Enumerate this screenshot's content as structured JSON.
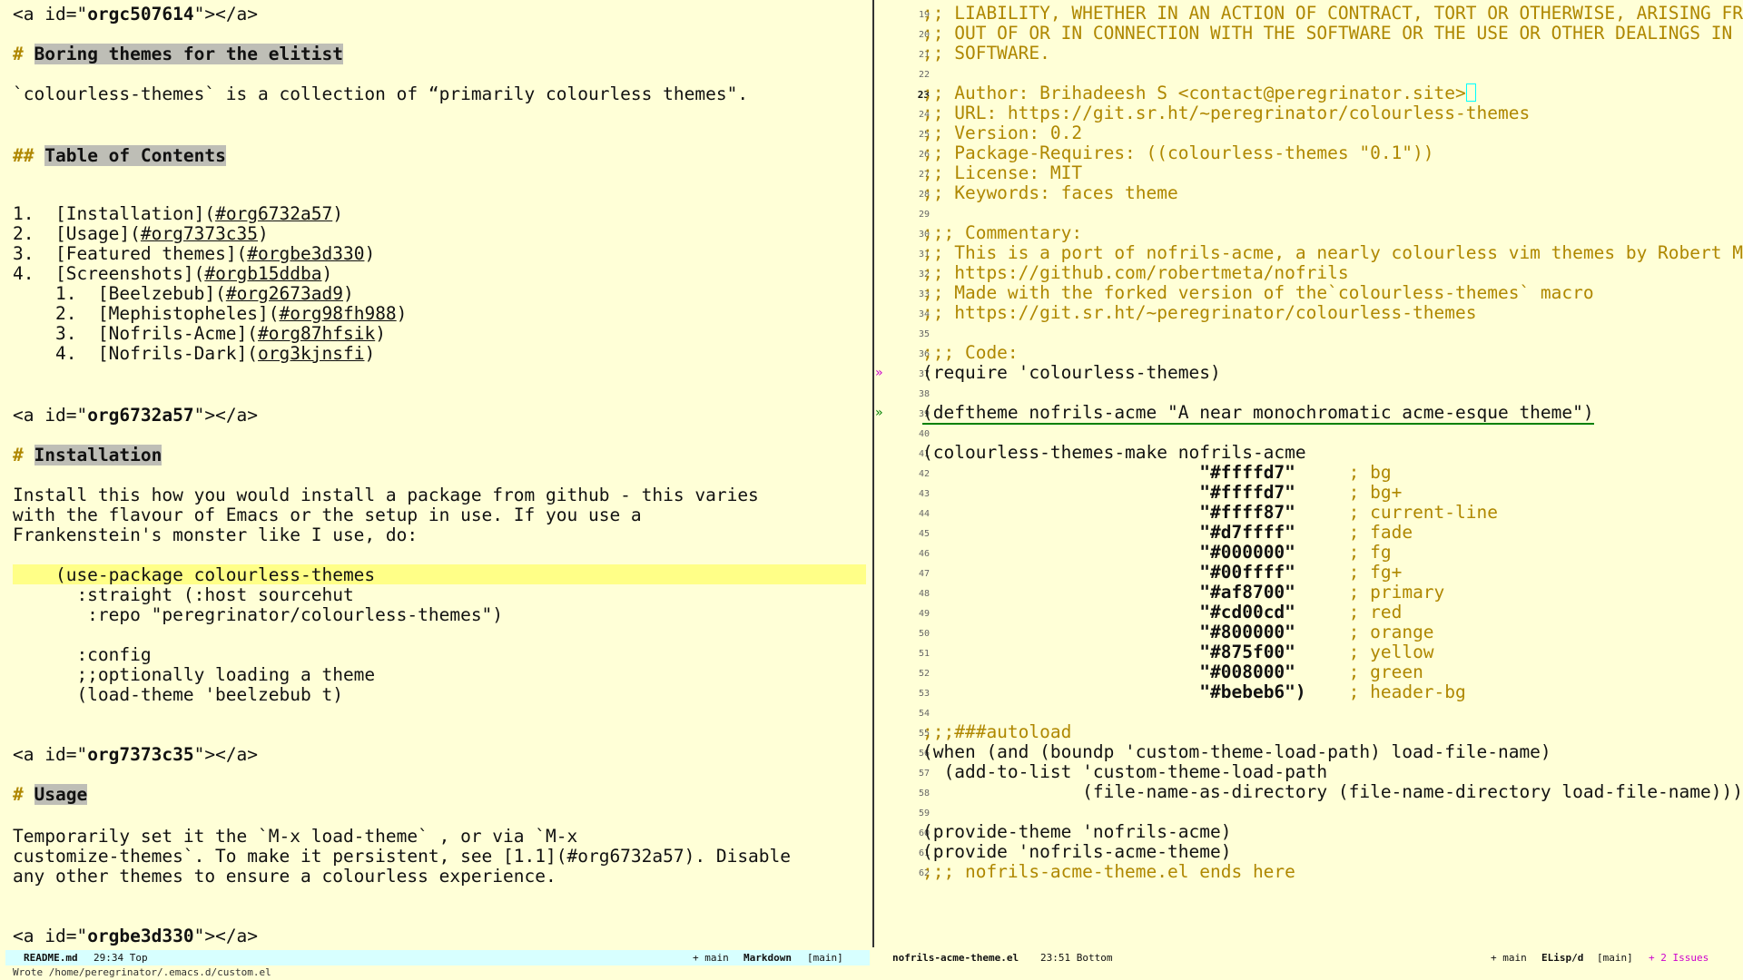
{
  "left_buffer": {
    "lines": [
      {
        "type": "anchor",
        "pre": "<a id=\"",
        "id": "orgc507614",
        "post": "\"></a>"
      },
      {
        "type": "h1",
        "hash": "#",
        "text": "Boring themes for the elitist"
      },
      {
        "type": "text",
        "text": "`colourless-themes` is a collection of “primarily colourless themes\"."
      },
      {
        "type": "h2",
        "hash": "##",
        "text": "Table of Contents"
      },
      {
        "type": "toc",
        "num": "1.",
        "label": "Installation",
        "ref": "#org6732a57"
      },
      {
        "type": "toc",
        "num": "2.",
        "label": "Usage",
        "ref": "#org7373c35"
      },
      {
        "type": "toc",
        "num": "3.",
        "label": "Featured themes",
        "ref": "#orgbe3d330"
      },
      {
        "type": "toc",
        "num": "4.",
        "label": "Screenshots",
        "ref": "#orgb15ddba"
      },
      {
        "type": "toc2",
        "num": "1.",
        "label": "Beelzebub",
        "ref": "#org2673ad9"
      },
      {
        "type": "toc2",
        "num": "2.",
        "label": "Mephistopheles",
        "ref": "#org98fh988"
      },
      {
        "type": "toc2",
        "num": "3.",
        "label": "Nofrils-Acme",
        "ref": "#org87hfsik"
      },
      {
        "type": "toc2",
        "num": "4.",
        "label": "Nofrils-Dark",
        "ref": "org3kjnsfi"
      },
      {
        "type": "anchor",
        "pre": "<a id=\"",
        "id": "org6732a57",
        "post": "\"></a>"
      },
      {
        "type": "h1",
        "hash": "#",
        "text": "Installation"
      },
      {
        "type": "text",
        "text": "Install this how you would install a package from github - this varies"
      },
      {
        "type": "text",
        "text": "with the flavour of Emacs or the setup in use. If you use a"
      },
      {
        "type": "text",
        "text": "Frankenstein's monster like I use, do:"
      },
      {
        "type": "code",
        "text": "    (use-package colourless-themes"
      },
      {
        "type": "code",
        "text": "      :straight (:host sourcehut"
      },
      {
        "type": "code",
        "text": "       :repo \"peregrinator/colourless-themes\")"
      },
      {
        "type": "code",
        "text": ""
      },
      {
        "type": "code",
        "text": "      :config"
      },
      {
        "type": "code",
        "text": "      ;;optionally loading a theme"
      },
      {
        "type": "code",
        "text": "      (load-theme 'beelzebub t)"
      },
      {
        "type": "anchor",
        "pre": "<a id=\"",
        "id": "org7373c35",
        "post": "\"></a>"
      },
      {
        "type": "h1",
        "hash": "#",
        "text": "Usage"
      },
      {
        "type": "text",
        "text": "Temporarily set it the `M-x load-theme` , or via `M-x"
      },
      {
        "type": "text",
        "text": "customize-themes`. To make it persistent, see [1.1](#org6732a57). Disable"
      },
      {
        "type": "text",
        "text": "any other themes to ensure a colourless experience."
      },
      {
        "type": "anchor",
        "pre": "<a id=\"",
        "id": "orgbe3d330",
        "post": "\"></a>"
      }
    ]
  },
  "right_buffer": {
    "lines": [
      {
        "n": "19",
        "text": ";; LIABILITY, WHETHER IN AN ACTION OF CONTRACT, TORT OR OTHERWISE, ARISING FROM,"
      },
      {
        "n": "20",
        "text": ";; OUT OF OR IN CONNECTION WITH THE SOFTWARE OR THE USE OR OTHER DEALINGS IN THE"
      },
      {
        "n": "21",
        "text": ";; SOFTWARE."
      },
      {
        "n": "22",
        "text": ""
      },
      {
        "n": "23",
        "text": ";; Author: Brihadeesh S <contact@peregrinator.site>"
      },
      {
        "n": "24",
        "text": ";; URL: https://git.sr.ht/~peregrinator/colourless-themes"
      },
      {
        "n": "25",
        "text": ";; Version: 0.2"
      },
      {
        "n": "26",
        "text": ";; Package-Requires: ((colourless-themes \"0.1\"))"
      },
      {
        "n": "27",
        "text": ";; License: MIT"
      },
      {
        "n": "28",
        "text": ";; Keywords: faces theme"
      },
      {
        "n": "29",
        "text": ""
      },
      {
        "n": "30",
        "text": ";;; Commentary:"
      },
      {
        "n": "31",
        "text": ";; This is a port of nofrils-acme, a nearly colourless vim themes by Robert Melton"
      },
      {
        "n": "32",
        "text": ";; https://github.com/robertmeta/nofrils"
      },
      {
        "n": "33",
        "text": ";; Made with the forked version of the`colourless-themes` macro"
      },
      {
        "n": "34",
        "text": ";; https://git.sr.ht/~peregrinator/colourless-themes"
      },
      {
        "n": "35",
        "text": ""
      },
      {
        "n": "36",
        "text": ";;; Code:"
      },
      {
        "n": "37",
        "text": "(require 'colourless-themes)"
      },
      {
        "n": "38",
        "text": ""
      },
      {
        "n": "39",
        "text": "(deftheme nofrils-acme \"A near monochromatic acme-esque theme\")"
      },
      {
        "n": "40",
        "text": ""
      },
      {
        "n": "41",
        "text": "(colourless-themes-make nofrils-acme"
      },
      {
        "n": "42",
        "val": "\"#ffffd7\"",
        "cmt": "; bg"
      },
      {
        "n": "43",
        "val": "\"#ffffd7\"",
        "cmt": "; bg+"
      },
      {
        "n": "44",
        "val": "\"#ffff87\"",
        "cmt": "; current-line"
      },
      {
        "n": "45",
        "val": "\"#d7ffff\"",
        "cmt": "; fade"
      },
      {
        "n": "46",
        "val": "\"#000000\"",
        "cmt": "; fg"
      },
      {
        "n": "47",
        "val": "\"#00ffff\"",
        "cmt": "; fg+"
      },
      {
        "n": "48",
        "val": "\"#af8700\"",
        "cmt": "; primary"
      },
      {
        "n": "49",
        "val": "\"#cd00cd\"",
        "cmt": "; red"
      },
      {
        "n": "50",
        "val": "\"#800000\"",
        "cmt": "; orange"
      },
      {
        "n": "51",
        "val": "\"#875f00\"",
        "cmt": "; yellow"
      },
      {
        "n": "52",
        "val": "\"#008000\"",
        "cmt": "; green"
      },
      {
        "n": "53",
        "val": "\"#bebeb6\")",
        "cmt": "; header-bg"
      },
      {
        "n": "54",
        "text": ""
      },
      {
        "n": "55",
        "text": ";;;###autoload"
      },
      {
        "n": "56",
        "text": "(when (and (boundp 'custom-theme-load-path) load-file-name)"
      },
      {
        "n": "57",
        "text": "  (add-to-list 'custom-theme-load-path"
      },
      {
        "n": "58",
        "text": "               (file-name-as-directory (file-name-directory load-file-name))))"
      },
      {
        "n": "59",
        "text": ""
      },
      {
        "n": "60",
        "text": "(provide-theme 'nofrils-acme)"
      },
      {
        "n": "61",
        "text": "(provide 'nofrils-acme-theme)"
      },
      {
        "n": "62",
        "text": ";;; nofrils-acme-theme.el ends here"
      }
    ]
  },
  "modeline_left": {
    "filename": "README.md",
    "position": "29:34 Top",
    "branch": "+ main",
    "mode": "Markdown",
    "workspace": "[main]"
  },
  "modeline_right": {
    "filename": "nofrils-acme-theme.el",
    "position": "23:51 Bottom",
    "branch": "+ main",
    "mode": "ELisp/d",
    "workspace": "[main]",
    "issues": "+ 2 Issues"
  },
  "echo_area": "Wrote /home/peregrinator/.emacs.d/custom.el",
  "theme_colors": {
    "bg": "#ffffd7",
    "current_line": "#ffff87",
    "fade": "#d7ffff",
    "fg": "#000000",
    "primary": "#af8700",
    "header_bg": "#bebeb6"
  }
}
